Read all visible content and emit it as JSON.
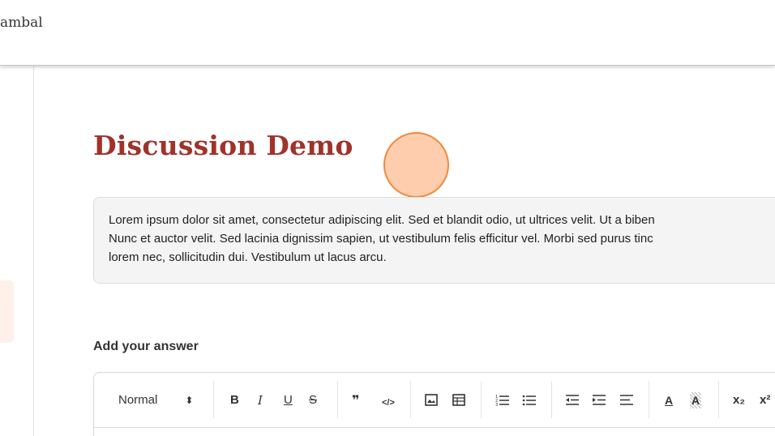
{
  "header": {
    "brand": "ambal"
  },
  "page": {
    "title": "Discussion Demo",
    "question": "Lorem ipsum dolor sit amet, consectetur adipiscing elit. Sed et blandit odio, ut ultrices velit. Ut a biben\nNunc et auctor velit. Sed lacinia dignissim sapien, ut vestibulum felis efficitur vel. Morbi sed purus tinc\nlorem nec, sollicitudin dui. Vestibulum ut lacus arcu.",
    "answer_label": "Add your answer"
  },
  "editor": {
    "format_select": "Normal",
    "format_arrows": "⬍",
    "buttons": {
      "bold": "B",
      "italic": "I",
      "underline": "U",
      "strike": "S",
      "quote": "❞",
      "code": "</>",
      "image": "🖼",
      "table": "▦",
      "ordered_list": "≡",
      "bullet_list": "☰",
      "outdent": "⇤",
      "indent": "⇥",
      "align": "≡",
      "text_color": "A",
      "highlight": "A",
      "subscript": "x₂",
      "superscript": "x²"
    },
    "icons": [
      "chevron-updown-icon",
      "quote-icon",
      "code-icon",
      "image-icon",
      "table-icon",
      "ordered-list-icon",
      "bullet-list-icon",
      "outdent-icon",
      "indent-icon",
      "align-icon",
      "text-color-icon",
      "highlight-icon"
    ]
  },
  "colors": {
    "title": "#a0322a",
    "cursor_fill": "#fdc4a0",
    "cursor_border": "#f08a3c",
    "question_bg": "#f4f4f4"
  }
}
